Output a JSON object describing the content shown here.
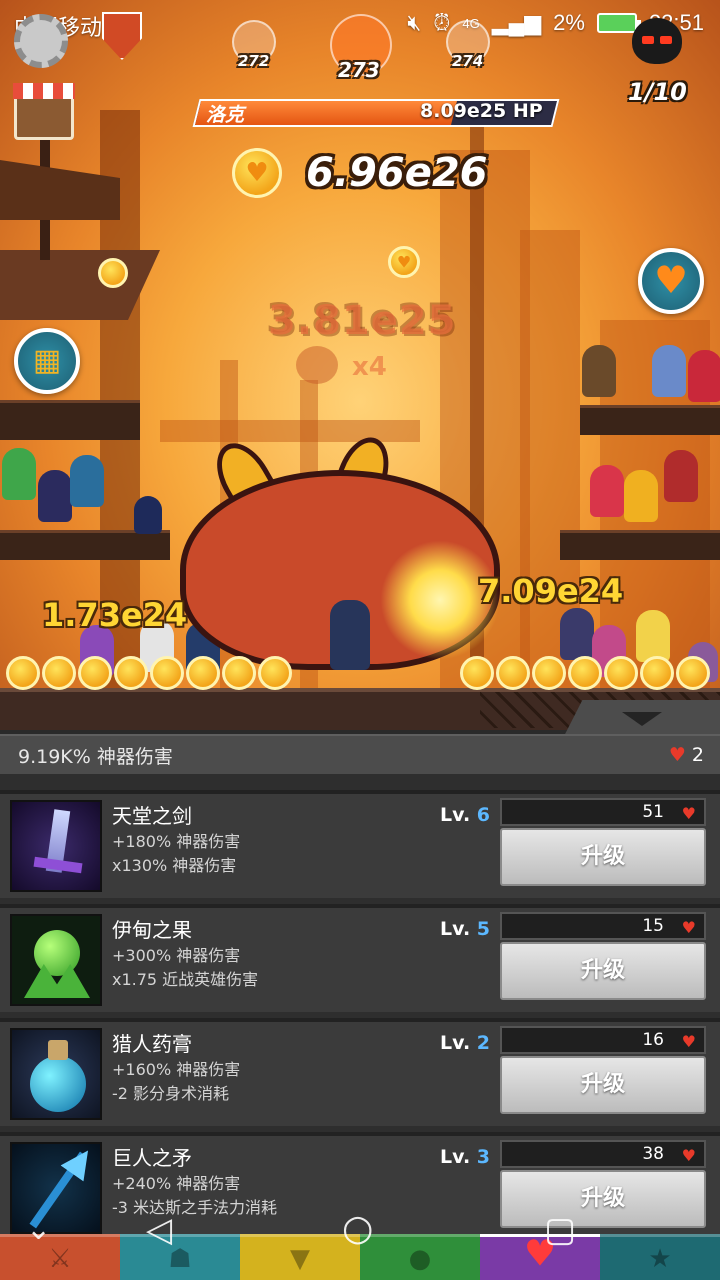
{
  "status_bar": {
    "carrier": "中国移动 4G",
    "network": "4G",
    "battery": "2%",
    "time": "22:51"
  },
  "hud": {
    "stages": {
      "prev": "272",
      "current": "273",
      "next": "274"
    },
    "kills": "1/10",
    "boss_name": "洛克",
    "boss_hp": "8.09e25 HP",
    "boss_hp_fraction": 0.72,
    "gold": "6.96e26",
    "tap_damage": "3.81e25",
    "combo": "x4",
    "floating_damage": [
      "1.73e24",
      "7.09e24"
    ]
  },
  "icons": {
    "settings": "gear-icon",
    "clan": "shield-icon",
    "boss": "demon-icon",
    "shop": "shop-icon",
    "chest": "treasure-chest-icon",
    "heart": "heart-icon"
  },
  "panel": {
    "bonus": "9.19K% 神器伤害",
    "relics": "2",
    "upgrade_label": "升级",
    "lv_prefix": "Lv.",
    "items": [
      {
        "name": "天堂之剑",
        "effect1": "+180% 神器伤害",
        "effect2": "x130% 神器伤害",
        "level": "6",
        "cost": "51",
        "thumb": "sword-icon"
      },
      {
        "name": "伊甸之果",
        "effect1": "+300% 神器伤害",
        "effect2": "x1.75 近战英雄伤害",
        "level": "5",
        "cost": "15",
        "thumb": "fruit-icon"
      },
      {
        "name": "猎人药膏",
        "effect1": "+160% 神器伤害",
        "effect2": "-2 影分身术消耗",
        "level": "2",
        "cost": "16",
        "thumb": "potion-icon"
      },
      {
        "name": "巨人之矛",
        "effect1": "+240% 神器伤害",
        "effect2": "-3 米达斯之手法力消耗",
        "level": "3",
        "cost": "38",
        "thumb": "spear-icon"
      }
    ]
  },
  "tabs": [
    {
      "name": "hero-tab",
      "icon": "sword-icon",
      "color": "#c8502e"
    },
    {
      "name": "heroes-tab",
      "icon": "heroes-icon",
      "color": "#2a8a94"
    },
    {
      "name": "equipment-tab",
      "icon": "shirt-icon",
      "color": "#d4b21e"
    },
    {
      "name": "pets-tab",
      "icon": "pet-icon",
      "color": "#2f8f3a"
    },
    {
      "name": "artifacts-tab",
      "icon": "artifact-heart-icon",
      "color": "#7a3aa6",
      "active": true
    },
    {
      "name": "shop-tab",
      "icon": "star-icon",
      "color": "#1e6a72"
    }
  ],
  "nav": {
    "back": "back-icon",
    "home": "home-icon",
    "recents": "recents-icon",
    "hide": "chevron-down-icon"
  }
}
